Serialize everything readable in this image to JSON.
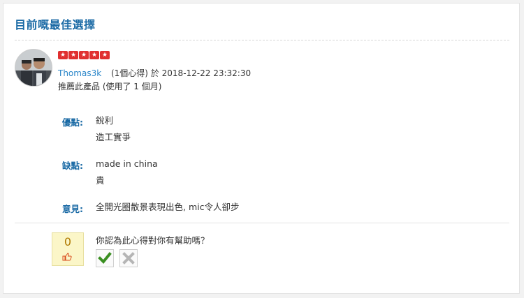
{
  "section_title": "目前嘅最佳選擇",
  "review": {
    "rating_stars": 5,
    "username": "Thomas3k",
    "review_count": "(1個心得)",
    "date_prefix": "於",
    "datetime": "2018-12-22 23:32:30",
    "recommendation": "推薦此產品 (使用了 1 個月)"
  },
  "pros": {
    "label": "優點:",
    "values": [
      "銳利",
      "造工實爭"
    ]
  },
  "cons": {
    "label": "缺點:",
    "values": [
      "made in china",
      "貴"
    ]
  },
  "opinion": {
    "label": "意見:",
    "value": "全開光圈散景表現出色, mic令人卻步"
  },
  "helpful": {
    "count": "0",
    "question": "你認為此心得對你有幫助嗎？"
  },
  "colors": {
    "accent": "#1a6aa5",
    "link": "#2a86c9",
    "star": "#e03030",
    "vote_bg": "#fbf6c8"
  },
  "icons": {
    "rating": "star-icon",
    "thumb": "thumbs-up-icon",
    "yes": "check-icon",
    "no": "cross-icon"
  }
}
